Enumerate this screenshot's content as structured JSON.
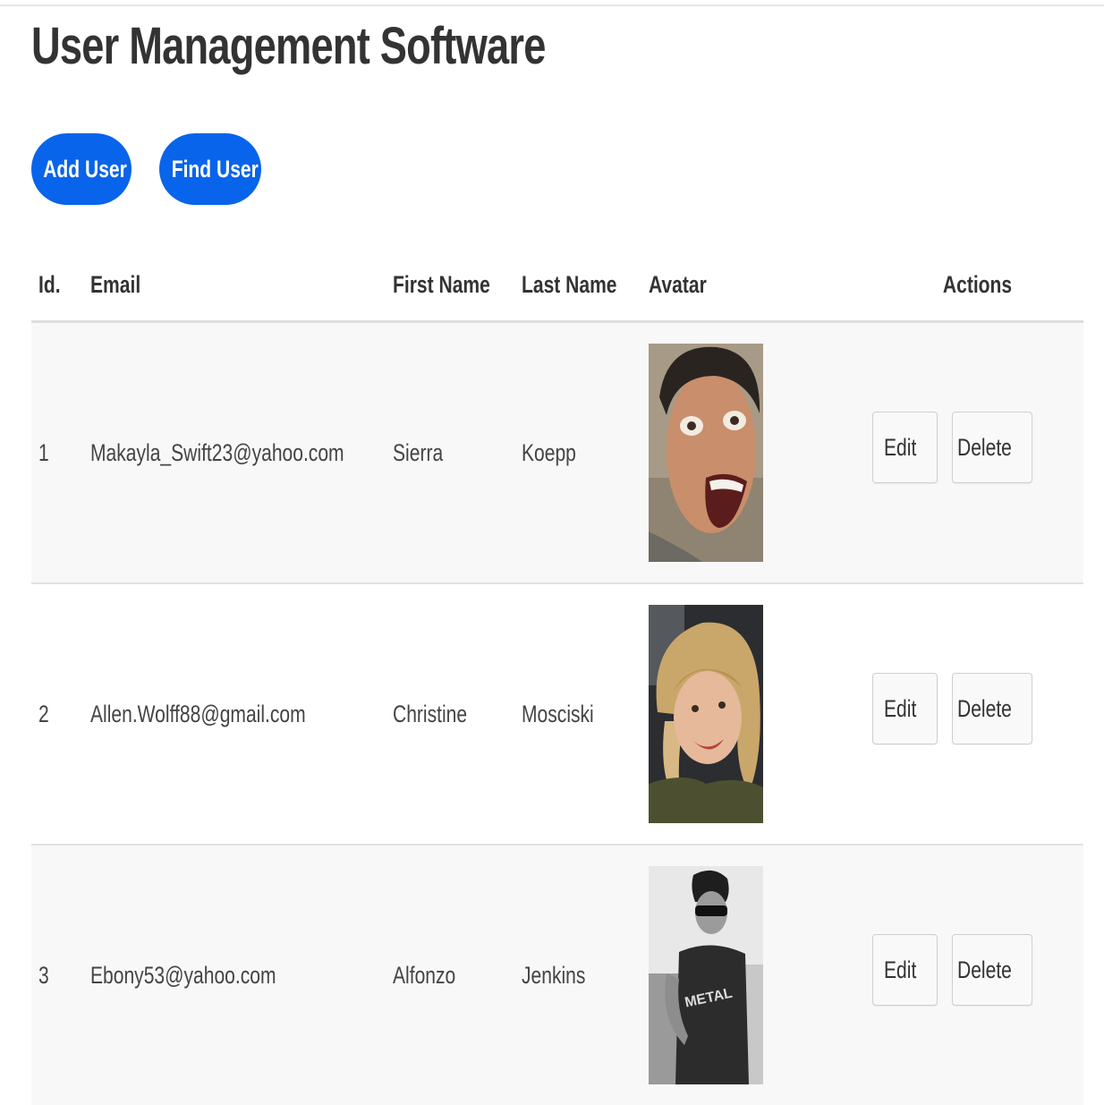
{
  "page": {
    "title": "User Management Software"
  },
  "toolbar": {
    "add_label": "Add User",
    "find_label": "Find User"
  },
  "colors": {
    "primary": "#0864ea",
    "row_alt": "#f8f8f8"
  },
  "table": {
    "headers": {
      "id": "Id.",
      "email": "Email",
      "first_name": "First Name",
      "last_name": "Last Name",
      "avatar": "Avatar",
      "actions": "Actions"
    },
    "rows": [
      {
        "id": "1",
        "email": "Makayla_Swift23@yahoo.com",
        "first_name": "Sierra",
        "last_name": "Koepp",
        "edit_label": "Edit",
        "delete_label": "Delete"
      },
      {
        "id": "2",
        "email": "Allen.Wolff88@gmail.com",
        "first_name": "Christine",
        "last_name": "Mosciski",
        "edit_label": "Edit",
        "delete_label": "Delete"
      },
      {
        "id": "3",
        "email": "Ebony53@yahoo.com",
        "first_name": "Alfonzo",
        "last_name": "Jenkins",
        "edit_label": "Edit",
        "delete_label": "Delete"
      }
    ]
  }
}
